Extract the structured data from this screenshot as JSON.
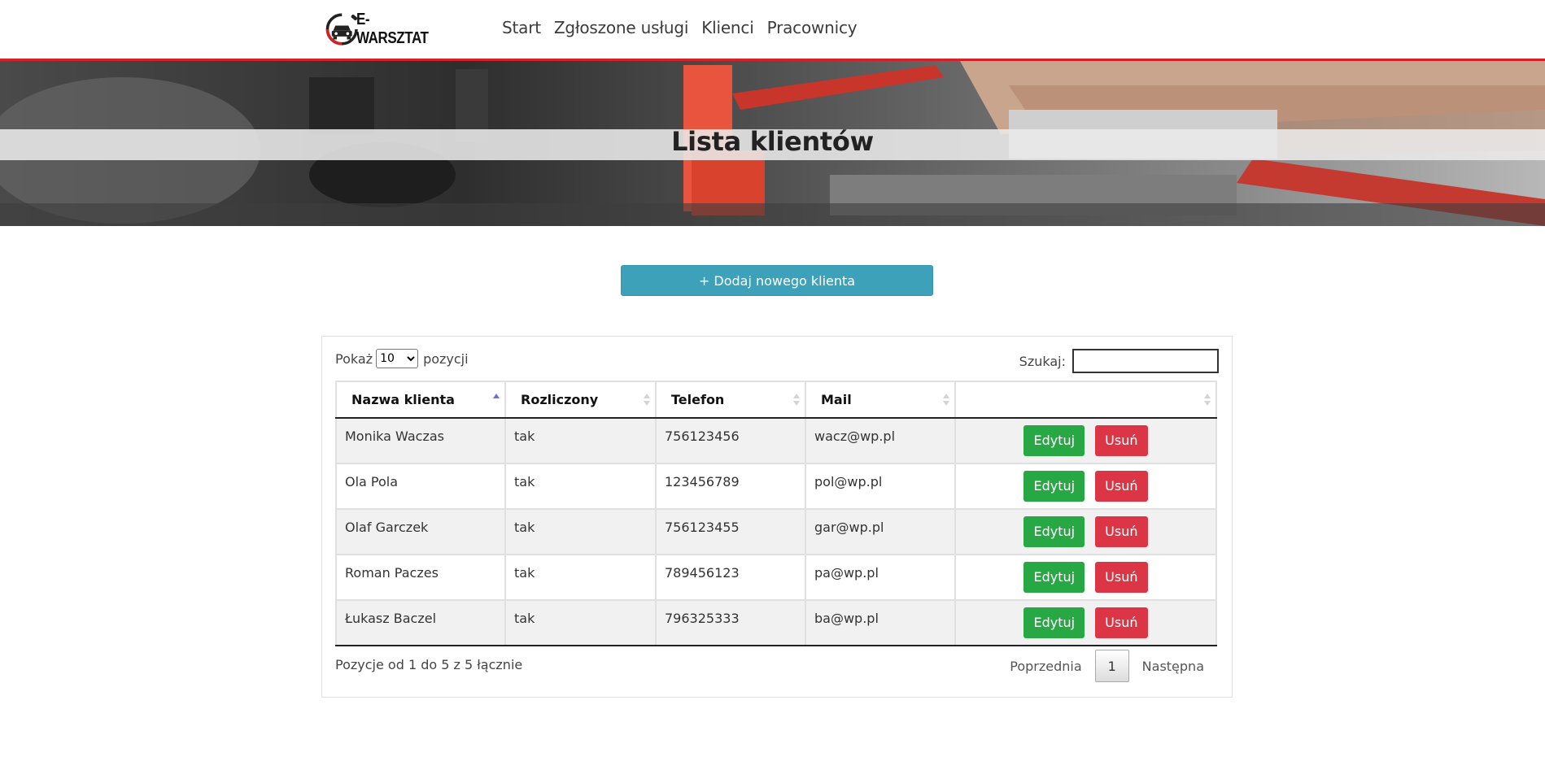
{
  "brand": {
    "name": "E-WARSZTAT"
  },
  "nav": [
    {
      "label": "Start"
    },
    {
      "label": "Zgłoszone usługi"
    },
    {
      "label": "Klienci"
    },
    {
      "label": "Pracownicy"
    }
  ],
  "hero": {
    "title": "Lista klientów"
  },
  "actions": {
    "add_label": "+ Dodaj nowego klienta"
  },
  "table": {
    "length_prefix": "Pokaż",
    "length_value": "10",
    "length_suffix": "pozycji",
    "search_label": "Szukaj:",
    "search_value": "",
    "columns": [
      "Nazwa klienta",
      "Rozliczony",
      "Telefon",
      "Mail",
      ""
    ],
    "rows": [
      {
        "name": "Monika Waczas",
        "settled": "tak",
        "phone": "756123456",
        "mail": "wacz@wp.pl"
      },
      {
        "name": "Ola Pola",
        "settled": "tak",
        "phone": "123456789",
        "mail": "pol@wp.pl"
      },
      {
        "name": "Olaf Garczek",
        "settled": "tak",
        "phone": "756123455",
        "mail": "gar@wp.pl"
      },
      {
        "name": "Roman Paczes",
        "settled": "tak",
        "phone": "789456123",
        "mail": "pa@wp.pl"
      },
      {
        "name": "Łukasz Baczel",
        "settled": "tak",
        "phone": "796325333",
        "mail": "ba@wp.pl"
      }
    ],
    "edit_label": "Edytuj",
    "delete_label": "Usuń",
    "info": "Pozycje od 1 do 5 z 5 łącznie",
    "pagination": {
      "prev": "Poprzednia",
      "current": "1",
      "next": "Następna"
    }
  },
  "colors": {
    "accent_red": "#d61f26",
    "primary_button": "#3ea1ba",
    "edit": "#28a745",
    "delete": "#dc3545"
  }
}
